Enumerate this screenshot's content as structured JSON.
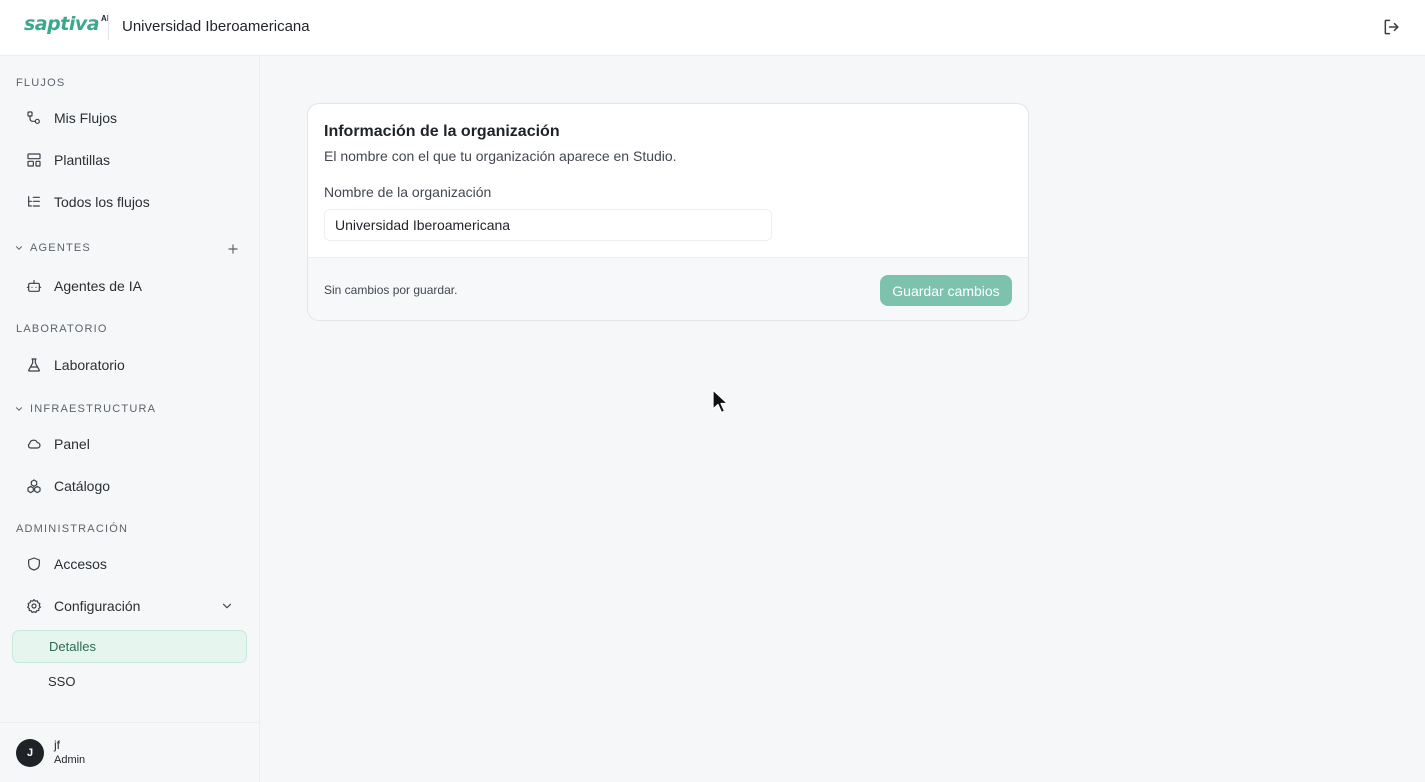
{
  "header": {
    "logo_text": "saptiva",
    "logo_suffix": "AI",
    "org_name": "Universidad Iberoamericana"
  },
  "sidebar": {
    "sections": {
      "flujos": "FLUJOS",
      "agentes": "AGENTES",
      "laboratorio": "LABORATORIO",
      "infraestructura": "INFRAESTRUCTURA",
      "administracion": "ADMINISTRACIÓN"
    },
    "items": {
      "mis_flujos": "Mis Flujos",
      "plantillas": "Plantillas",
      "todos_flujos": "Todos los flujos",
      "agentes_ia": "Agentes de IA",
      "laboratorio": "Laboratorio",
      "panel": "Panel",
      "catalogo": "Catálogo",
      "accesos": "Accesos",
      "configuracion": "Configuración"
    },
    "subitems": {
      "detalles": "Detalles",
      "sso": "SSO"
    },
    "active": "Detalles"
  },
  "user": {
    "initial": "J",
    "name": "jf",
    "role": "Admin"
  },
  "card": {
    "title": "Información de la organización",
    "description": "El nombre con el que tu organización aparece en Studio.",
    "field_label": "Nombre de la organización",
    "field_value": "Universidad Iberoamericana",
    "footer_status": "Sin cambios por guardar.",
    "save_label": "Guardar cambios"
  },
  "colors": {
    "brand": "#3aa88c",
    "active_bg": "#e6f6ef",
    "save_disabled": "#7dc2ad"
  }
}
